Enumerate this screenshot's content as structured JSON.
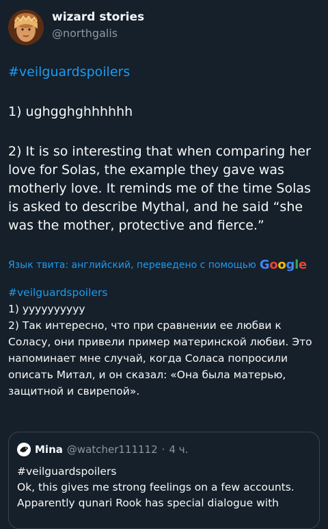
{
  "author": {
    "display_name": "wizard stories",
    "handle": "@northgalis"
  },
  "tweet": {
    "hashtag": "#veilguardspoilers",
    "paragraph_1": "1) ughgghghhhhhh",
    "paragraph_2": "2) It is so interesting that when comparing her love for Solas, the example they gave was motherly love. It reminds me of the time Solas is asked to describe Mythal, and he said “she was the mother, protective and fierce.”"
  },
  "translation": {
    "note": "Язык твита: английский, переведено с помощью",
    "provider": "Google",
    "hashtag": "#veilguardspoilers",
    "paragraph_1": "1) уууууууууу",
    "paragraph_2": "2) Так интересно, что при сравнении ее любви к Соласу, они привели пример материнской любви. Это напоминает мне случай, когда Соласа попросили описать Митал, и он сказал: «Она была матерью, защитной и свирепой»."
  },
  "quote": {
    "name": "Mina",
    "handle": "@watcher111112",
    "separator": "·",
    "time": "4 ч.",
    "hashtag": "#veilguardspoilers",
    "text": "Ok, this gives me strong feelings on a few accounts. Apparently qunari Rook has special dialogue with"
  },
  "colors": {
    "background": "#15202b",
    "text": "#f7f9f9",
    "secondary_text": "#8b98a5",
    "accent": "#1d9bf0",
    "border": "#38444d"
  },
  "icons": {
    "author_avatar": "avatar-portrait-icon",
    "quote_avatar": "avatar-bird-icon"
  }
}
